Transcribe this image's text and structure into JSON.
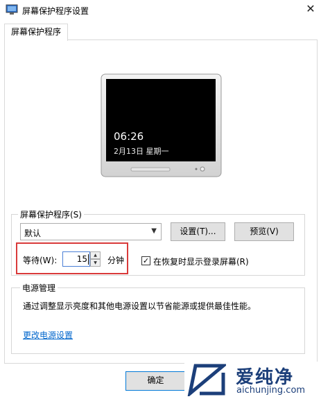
{
  "window": {
    "title": "屏幕保护程序设置",
    "close_symbol": "✕"
  },
  "tab": {
    "label": "屏幕保护程序"
  },
  "preview": {
    "time": "06:26",
    "date": "2月13日 星期一"
  },
  "screensaver": {
    "group_label": "屏幕保护程序(S)",
    "selected": "默认",
    "settings_button": "设置(T)...",
    "preview_button": "预览(V)",
    "wait_label": "等待(W):",
    "wait_value": "15",
    "unit": "分钟",
    "resume_label": "在恢复时显示登录屏幕(R)",
    "resume_checked": "✓"
  },
  "power": {
    "group_label": "电源管理",
    "description": "通过调整显示亮度和其他电源设置以节省能源或提供最佳性能。",
    "link": "更改电源设置"
  },
  "buttons": {
    "ok": "确定"
  },
  "watermark": {
    "cn": "爱纯净",
    "en": "aichunjing.com"
  }
}
